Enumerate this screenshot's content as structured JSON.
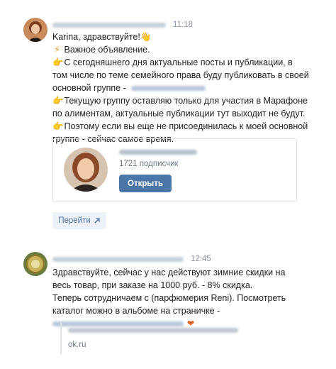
{
  "messages": [
    {
      "time": "11:18",
      "greeting": "Karina, здравствуйте!",
      "lines": {
        "l1": "Важное объявление.",
        "l2": "С сегодняшнего дня актуальные посты и публикации, в",
        "l3": "том числе по теме семейного права буду публиковать в своей",
        "l4": "основной группе -",
        "l5": "Текущую группу оставляю только для участия в Марафоне",
        "l6": "по алиментам, актуальные публикации тут выходит не будут.",
        "l7": "Поэтому если вы еще не присоединилась к моей основной",
        "l8": "группе - сейчас самое время."
      },
      "card": {
        "subscribers": "1721 подписчик",
        "open_label": "Открыть"
      },
      "goto_label": "Перейти"
    },
    {
      "time": "12:45",
      "lines": {
        "l1": "Здравствуйте, сейчас у нас действуют зимние скидки на",
        "l2": "весь товар, при заказе на 1000 руб. - 8% скидка.",
        "l3": "Теперь сотрудничаем с (парфюмерия Reni). Посмотреть",
        "l4": "каталог можно в альбоме на страничке -"
      },
      "snippet": {
        "domain": "ok.ru"
      }
    }
  ],
  "colors": {
    "accent": "#4a76a8",
    "time": "#8a93a0",
    "muted": "#6d7885"
  },
  "icons": [
    "waving-hand-icon",
    "lightning-icon",
    "pointing-hand-icon",
    "heart-icon",
    "external-arrow-icon"
  ]
}
